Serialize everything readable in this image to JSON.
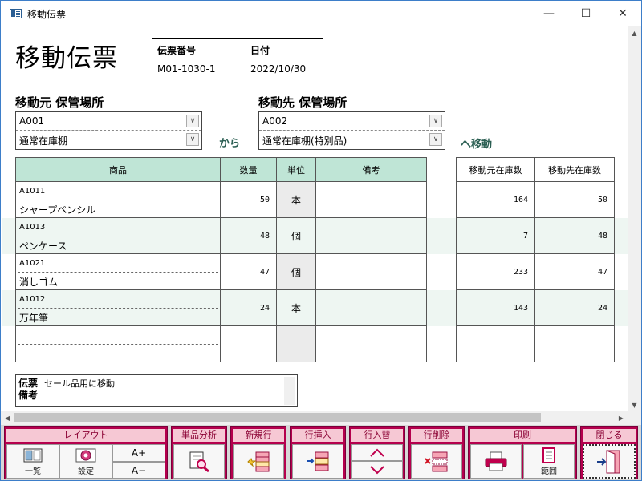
{
  "window": {
    "title": "移動伝票",
    "min": "—",
    "max": "☐",
    "close": "✕"
  },
  "header": {
    "title": "移動伝票",
    "slip_no_label": "伝票番号",
    "slip_no": "M01-1030-1",
    "date_label": "日付",
    "date": "2022/10/30"
  },
  "from": {
    "label": "移動元 保管場所",
    "code": "A001",
    "name": "通常在庫棚"
  },
  "to": {
    "label": "移動先 保管場所",
    "code": "A002",
    "name": "通常在庫棚(特別品)"
  },
  "kara": "から",
  "he_idou": "へ移動",
  "grid": {
    "headers": {
      "item": "商品",
      "qty": "数量",
      "unit": "単位",
      "note": "備考",
      "src_stock": "移動元在庫数",
      "dst_stock": "移動先在庫数"
    },
    "rows": [
      {
        "code": "A1011",
        "name": "シャープペンシル",
        "qty": "50",
        "unit": "本",
        "note": "",
        "src": "164",
        "dst": "50"
      },
      {
        "code": "A1013",
        "name": "ペンケース",
        "qty": "48",
        "unit": "個",
        "note": "",
        "src": "7",
        "dst": "48"
      },
      {
        "code": "A1021",
        "name": "消しゴム",
        "qty": "47",
        "unit": "個",
        "note": "",
        "src": "233",
        "dst": "47"
      },
      {
        "code": "A1012",
        "name": "万年筆",
        "qty": "24",
        "unit": "本",
        "note": "",
        "src": "143",
        "dst": "24"
      }
    ]
  },
  "memo": {
    "label": "伝票備考",
    "text": "セール品用に移動"
  },
  "toolbar": {
    "layout": {
      "label": "レイアウト",
      "list": "一覧",
      "settings": "設定",
      "font_up": "A+",
      "font_down": "A−"
    },
    "analysis": {
      "label": "単品分析"
    },
    "new_row": {
      "label": "新規行"
    },
    "insert_row": {
      "label": "行挿入"
    },
    "swap_row": {
      "label": "行入替"
    },
    "delete_row": {
      "label": "行削除"
    },
    "print": {
      "label": "印刷",
      "range": "範囲"
    },
    "close": {
      "label": "閉じる"
    }
  },
  "colors": {
    "header_bg": "#bfe5d6",
    "toolbar_group": "#b5004d",
    "toolbar_label_bg": "#f6c8d4",
    "accent_text": "#2a5e52"
  }
}
